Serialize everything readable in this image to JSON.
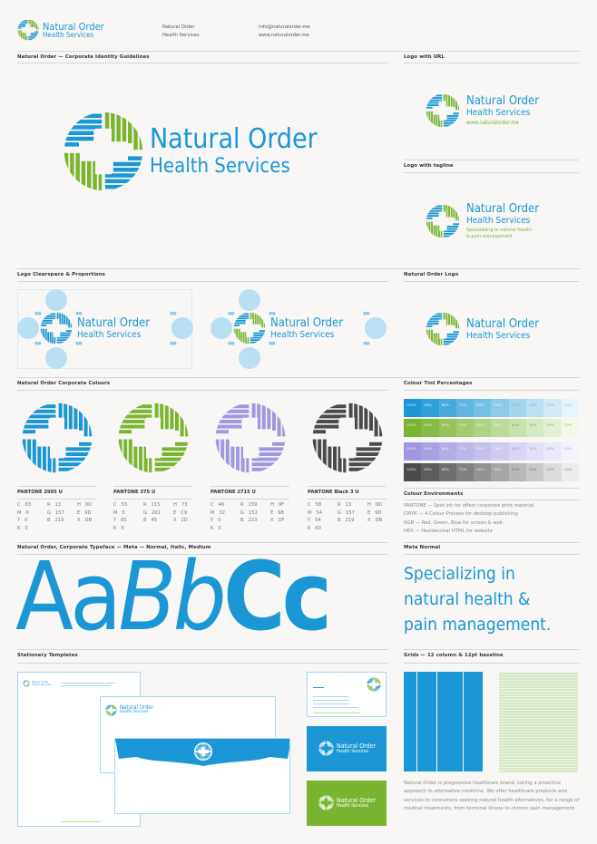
{
  "brand": {
    "name_line1": "Natural Order",
    "name_line2": "Health Services",
    "url": "www.naturalorder.me",
    "tagline_line1": "Specializing in natural health",
    "tagline_line2": "& pain management",
    "colors": {
      "blue": "#1a97d4",
      "green": "#7ab532",
      "purple": "#9f98df",
      "black": "#4a4c4a"
    }
  },
  "header": {
    "company_line1": "Natural Order",
    "company_line2": "Health Services",
    "email": "info@naturalorder.me",
    "website": "www.naturalorder.me"
  },
  "sections": {
    "guidelines": "Natural Order — Corporate Identity Guidelines",
    "logo_with_url": "Logo with URL",
    "logo_with_tagline": "Logo with tagline",
    "clearspace": "Logo Clearspace & Proportions",
    "natural_order_logo": "Natural Order Logo",
    "corporate_colours": "Natural Order Corporate Colours",
    "tint_percentages": "Colour Tint Percentages",
    "colour_environments": "Colour Environments",
    "typeface": "Natural Order, Corporate Typeface — Meta — Normal, Italic, Medium",
    "meta_normal": "Meta Normal",
    "stationery": "Stationery Templates",
    "grids": "Grids — 12 column & 12pt baseline"
  },
  "pantones": [
    {
      "name": "PANTONE 2995 U",
      "C": "83",
      "M": "0",
      "Y": "0",
      "K": "0",
      "R": "13",
      "G": "157",
      "B": "219",
      "H": "0D",
      "E": "9D",
      "X": "DB"
    },
    {
      "name": "PANTONE 375 U",
      "C": "53",
      "M": "0",
      "Y": "85",
      "K": "0",
      "R": "115",
      "G": "201",
      "B": "45",
      "H": "73",
      "E": "C9",
      "X": "2D"
    },
    {
      "name": "PANTONE 2715 U",
      "C": "46",
      "M": "32",
      "Y": "0",
      "K": "0",
      "R": "159",
      "G": "152",
      "B": "223",
      "H": "9F",
      "E": "98",
      "X": "DF"
    },
    {
      "name": "PANTONE Black 3 U",
      "C": "58",
      "M": "54",
      "Y": "54",
      "K": "60",
      "R": "13",
      "G": "157",
      "B": "219",
      "H": "0D",
      "E": "9D",
      "X": "DB"
    }
  ],
  "tints": {
    "percentages": [
      "100%",
      "90%",
      "80%",
      "70%",
      "60%",
      "50%",
      "40%",
      "30%",
      "20%",
      "10%"
    ],
    "rows": [
      {
        "name": "blue",
        "colors": [
          "#1a97d4",
          "#2fa0d8",
          "#47abdc",
          "#5fb6e1",
          "#76c0e5",
          "#8ccbe9",
          "#a3d5ed",
          "#bae0f2",
          "#d1eaf6",
          "#e8f5fb"
        ]
      },
      {
        "name": "green",
        "colors": [
          "#7ab532",
          "#87bc46",
          "#95c45b",
          "#a2cb70",
          "#afd284",
          "#bcda98",
          "#c9e1ad",
          "#d7e9c1",
          "#e4f0d6",
          "#f2f8ea"
        ]
      },
      {
        "name": "purple",
        "colors": [
          "#9f98df",
          "#a9a2e2",
          "#b2ade5",
          "#bbb7e9",
          "#c5c1ec",
          "#cecbef",
          "#d8d6f2",
          "#e2e0f5",
          "#ebeaf9",
          "#f5f4fc"
        ]
      },
      {
        "name": "black",
        "colors": [
          "#4a4c4a",
          "#5c5e5c",
          "#6e706e",
          "#808280",
          "#929492",
          "#a5a6a5",
          "#b7b7b7",
          "#c9c9c9",
          "#dbdbdb",
          "#ededed"
        ]
      }
    ]
  },
  "colour_environments": [
    "PANTONE — Spot ink for offest corporate print material",
    "CMYK — 4 Colour Process for desktop publishing",
    "RGB — Red, Green, Blue for screen & web",
    "HEX — Hexidecimal HTML for website"
  ],
  "typeface": {
    "specimen_normal": "Aa",
    "specimen_italic": "Bb",
    "specimen_medium": "Cc",
    "meta_sample_line1": "Specializing in",
    "meta_sample_line2": "natural health &",
    "meta_sample_line3": "pain management."
  },
  "description": "Natural Order is progressive healthcare brand, taking a proactive approach to alternative medicine. We offer healthcare products and services to consumers seeking natural health alternatives, for a range of medical treatments, from terminal illness to chronic pain management."
}
